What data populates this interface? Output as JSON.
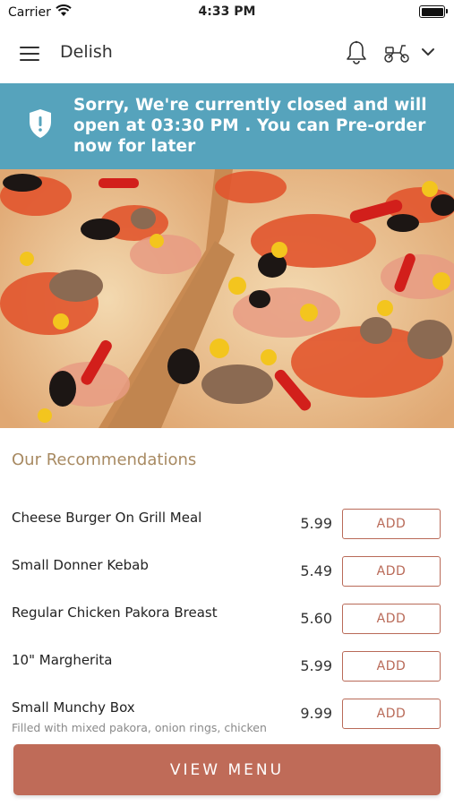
{
  "status_bar": {
    "carrier": "Carrier",
    "time": "4:33 PM"
  },
  "header": {
    "title": "Delish",
    "icons": [
      "menu-icon",
      "bell-icon",
      "scooter-icon",
      "chevron-down-icon"
    ]
  },
  "banner": {
    "message": "Sorry, We're currently closed and will open at 03:30 PM . You can Pre-order now for later",
    "icon": "shield-icon",
    "color": "#56a3bc"
  },
  "hero": {
    "image": "pizza"
  },
  "recommendations": {
    "title": "Our Recommendations",
    "items": [
      {
        "name": "Cheese Burger On Grill Meal",
        "price": "5.99",
        "add_label": "ADD"
      },
      {
        "name": "Small Donner Kebab",
        "price": "5.49",
        "add_label": "ADD"
      },
      {
        "name": "Regular Chicken Pakora Breast",
        "price": "5.60",
        "add_label": "ADD"
      },
      {
        "name": "10\" Margherita",
        "price": "5.99",
        "add_label": "ADD"
      },
      {
        "name": "Small Munchy Box",
        "description": "Filled with mixed pakora, onion rings, chicken",
        "price": "9.99",
        "add_label": "ADD"
      }
    ]
  },
  "footer": {
    "view_menu_label": "VIEW MENU"
  },
  "colors": {
    "accent": "#bf6b58",
    "section_title": "#a88a62"
  }
}
